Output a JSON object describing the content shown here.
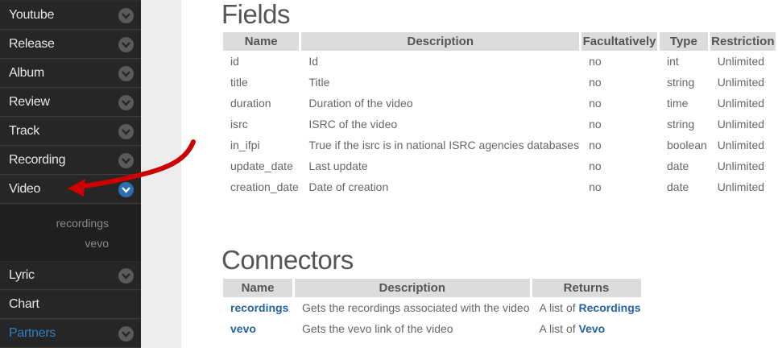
{
  "sidebar": {
    "items": [
      {
        "label": "Youtube"
      },
      {
        "label": "Release"
      },
      {
        "label": "Album"
      },
      {
        "label": "Review"
      },
      {
        "label": "Track"
      },
      {
        "label": "Recording"
      },
      {
        "label": "Video"
      },
      {
        "label": "Lyric"
      },
      {
        "label": "Chart"
      },
      {
        "label": "Partners"
      }
    ],
    "active_item": "Video",
    "submenu": [
      "recordings",
      "vevo"
    ]
  },
  "fields": {
    "title": "Fields",
    "headers": [
      "Name",
      "Description",
      "Facultatively",
      "Type",
      "Restriction"
    ],
    "rows": [
      {
        "name": "id",
        "description": "Id",
        "facultatively": "no",
        "type": "int",
        "restriction": "Unlimited"
      },
      {
        "name": "title",
        "description": "Title",
        "facultatively": "no",
        "type": "string",
        "restriction": "Unlimited"
      },
      {
        "name": "duration",
        "description": "Duration of the video",
        "facultatively": "no",
        "type": "time",
        "restriction": "Unlimited"
      },
      {
        "name": "isrc",
        "description": "ISRC of the video",
        "facultatively": "no",
        "type": "string",
        "restriction": "Unlimited"
      },
      {
        "name": "in_ifpi",
        "description": "True if the isrc is in national ISRC agencies databases",
        "facultatively": "no",
        "type": "boolean",
        "restriction": "Unlimited"
      },
      {
        "name": "update_date",
        "description": "Last update",
        "facultatively": "no",
        "type": "date",
        "restriction": "Unlimited"
      },
      {
        "name": "creation_date",
        "description": "Date of creation",
        "facultatively": "no",
        "type": "date",
        "restriction": "Unlimited"
      }
    ]
  },
  "connectors": {
    "title": "Connectors",
    "headers": [
      "Name",
      "Description",
      "Returns"
    ],
    "rows": [
      {
        "name": "recordings",
        "description": "Gets the recordings associated with the video",
        "returns_prefix": "A list of",
        "returns_link": "Recordings"
      },
      {
        "name": "vevo",
        "description": "Gets the vevo link of the video",
        "returns_prefix": "A list of",
        "returns_link": "Vevo"
      }
    ]
  },
  "colors": {
    "sidebar_bg": "#262626",
    "link": "#2563a6",
    "annotation_arrow": "#cc0000",
    "active_chevron": "#2a6fb0"
  }
}
